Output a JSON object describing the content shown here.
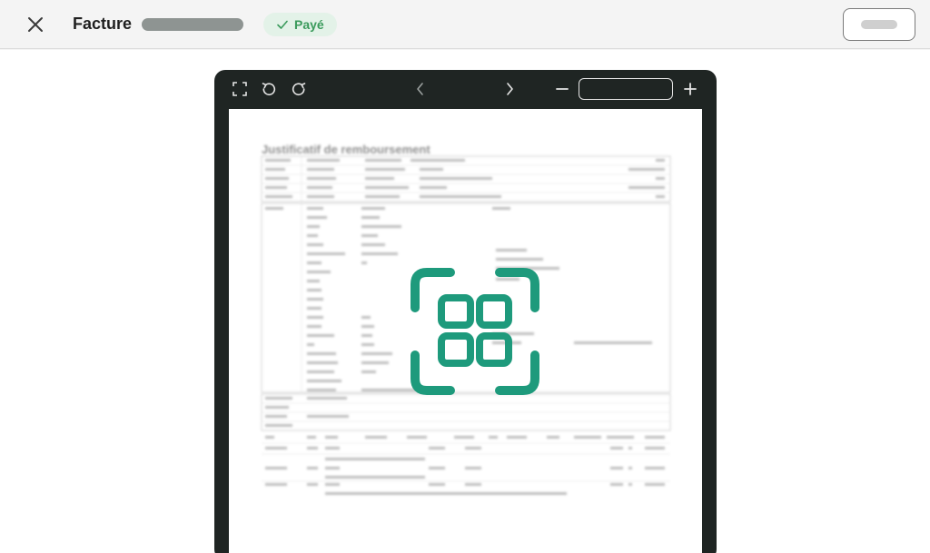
{
  "header": {
    "title": "Facture",
    "status_badge": "Payé"
  },
  "viewer": {
    "zoom_value": "",
    "document": {
      "title": "Justificatif de remboursement"
    }
  },
  "colors": {
    "accent": "#1e9a7c",
    "badge_bg": "#e3f2e8",
    "badge_text": "#3a9a5b",
    "viewer_bg": "#1f2523"
  },
  "icons": {
    "close": "close-icon",
    "check": "check-icon",
    "fullscreen": "fullscreen-icon",
    "rotate_left": "rotate-left-icon",
    "rotate_right": "rotate-right-icon",
    "previous": "chevron-left-icon",
    "next": "chevron-right-icon",
    "zoom_out": "minus-icon",
    "zoom_in": "plus-icon",
    "scan": "scan-icon"
  }
}
